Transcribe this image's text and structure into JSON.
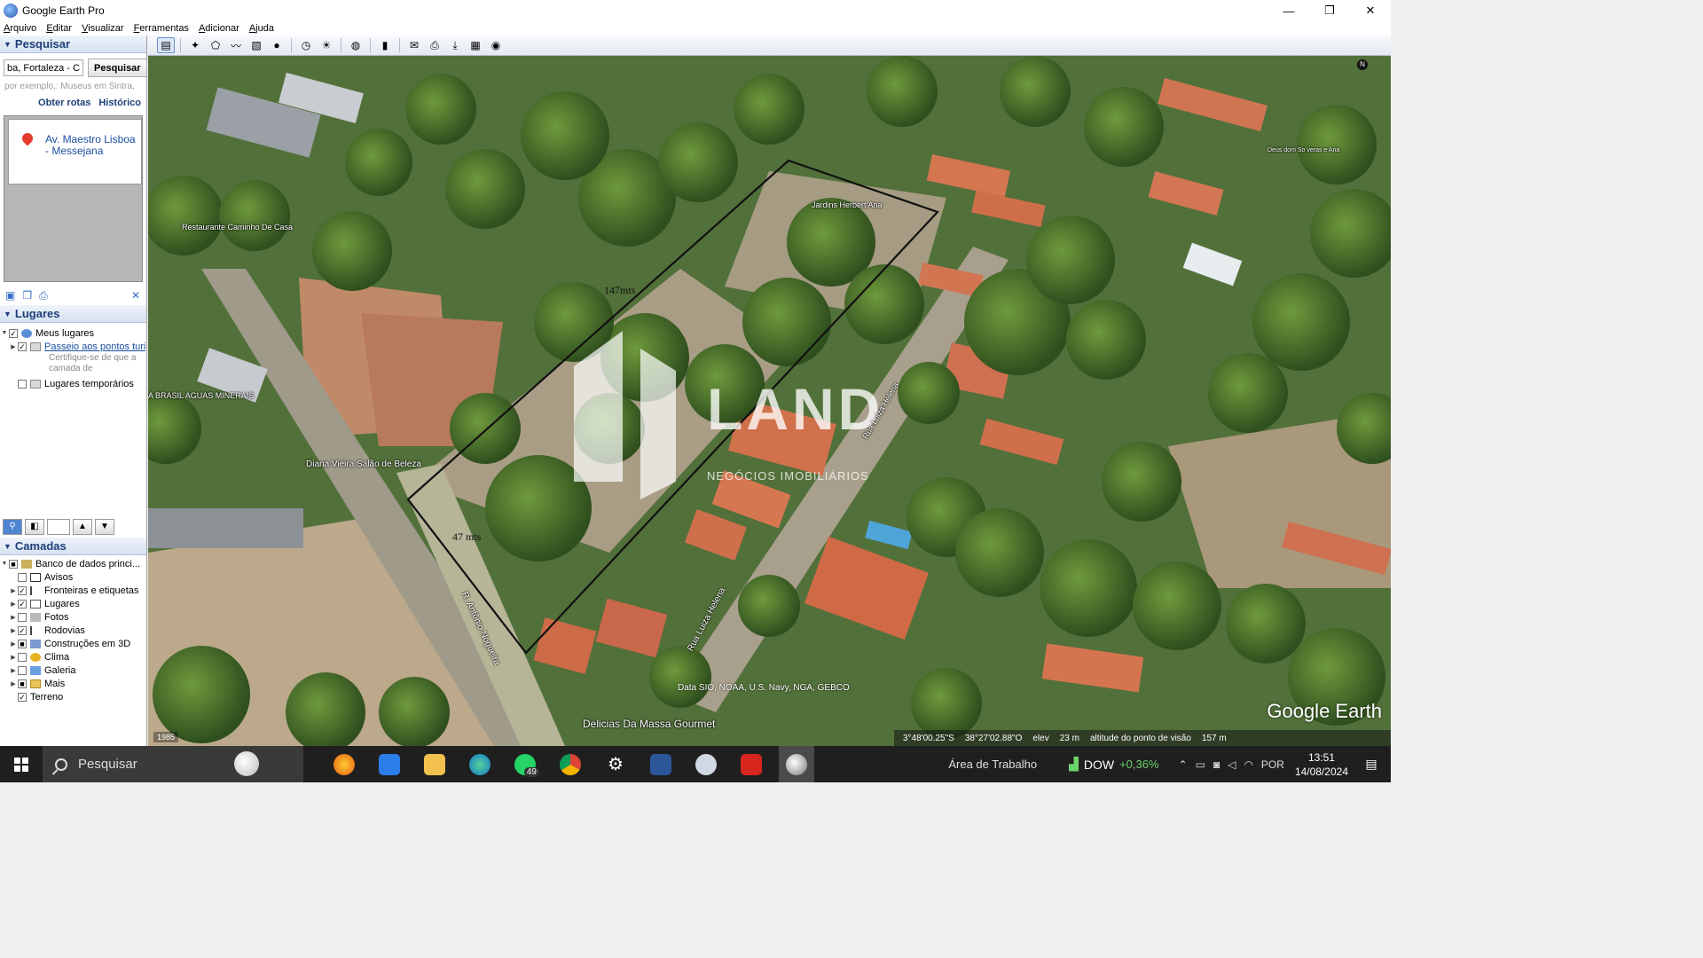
{
  "window": {
    "title": "Google Earth Pro",
    "minimize": "—",
    "maximize": "❐",
    "close": "✕"
  },
  "menu": [
    "Arquivo",
    "Editar",
    "Visualizar",
    "Ferramentas",
    "Adicionar",
    "Ajuda"
  ],
  "search": {
    "header": "Pesquisar",
    "value": "ba, Fortaleza - CE",
    "button": "Pesquisar",
    "hint": "por exemplo,: Museus em Sintra,",
    "routes": "Obter rotas",
    "history": "Histórico",
    "result": "Av. Maestro Lisboa - Messejana"
  },
  "places": {
    "header": "Lugares",
    "my_places": "Meus lugares",
    "tour": "Passeio aos pontos turi",
    "tour_note": "Certifique-se de que a camada de",
    "temporary": "Lugares temporários"
  },
  "layers": {
    "header": "Camadas",
    "items": [
      {
        "label": "Banco de dados princi...",
        "checked": "■"
      },
      {
        "label": "Avisos",
        "checked": ""
      },
      {
        "label": "Fronteiras e etiquetas",
        "checked": "✓"
      },
      {
        "label": "Lugares",
        "checked": "✓"
      },
      {
        "label": "Fotos",
        "checked": ""
      },
      {
        "label": "Rodovias",
        "checked": "✓"
      },
      {
        "label": "Construções em 3D",
        "checked": "■"
      },
      {
        "label": "Clima",
        "checked": ""
      },
      {
        "label": "Galeria",
        "checked": ""
      },
      {
        "label": "Mais",
        "checked": "■"
      },
      {
        "label": "Terreno",
        "checked": "✓"
      }
    ]
  },
  "map": {
    "labels": {
      "restaurant": "Restaurante Caminho De Casa",
      "jardins": "Jardins Herbert Ana",
      "salao": "Diana Vieira Salão de Beleza",
      "aguas": "A BRASIL AGUAS MINERAIS",
      "street1": "R. Antônio Nogueira",
      "street2": "Rua Luiza Helena",
      "street3": "Rua Luiza Helena",
      "delicias": "Delicias Da Massa Gourmet",
      "deus": "Deus dom So veras e Ana"
    },
    "measure_long": "147mts",
    "measure_short": "47 mts",
    "watermark_title": "LAND",
    "watermark_sub": "NEGÓCIOS IMOBILIÁRIOS",
    "credit": "Data SIO, NOAA, U.S. Navy, NGA, GEBCO",
    "year": "1985",
    "logo": "Google Earth",
    "north": "N",
    "status": {
      "lat": "3°48'00.25\"S",
      "lon": "38°27'02.88\"O",
      "elev_label": "elev",
      "elev": "23 m",
      "eye_label": "altitude do ponto de visão",
      "eye": "157 m"
    }
  },
  "taskbar": {
    "search": "Pesquisar",
    "whatsapp_badge": "49",
    "desktop": "Área de Trabalho",
    "stock_name": "DOW",
    "stock_change": "+0,36%",
    "lang": "POR",
    "time": "13:51",
    "date": "14/08/2024"
  }
}
